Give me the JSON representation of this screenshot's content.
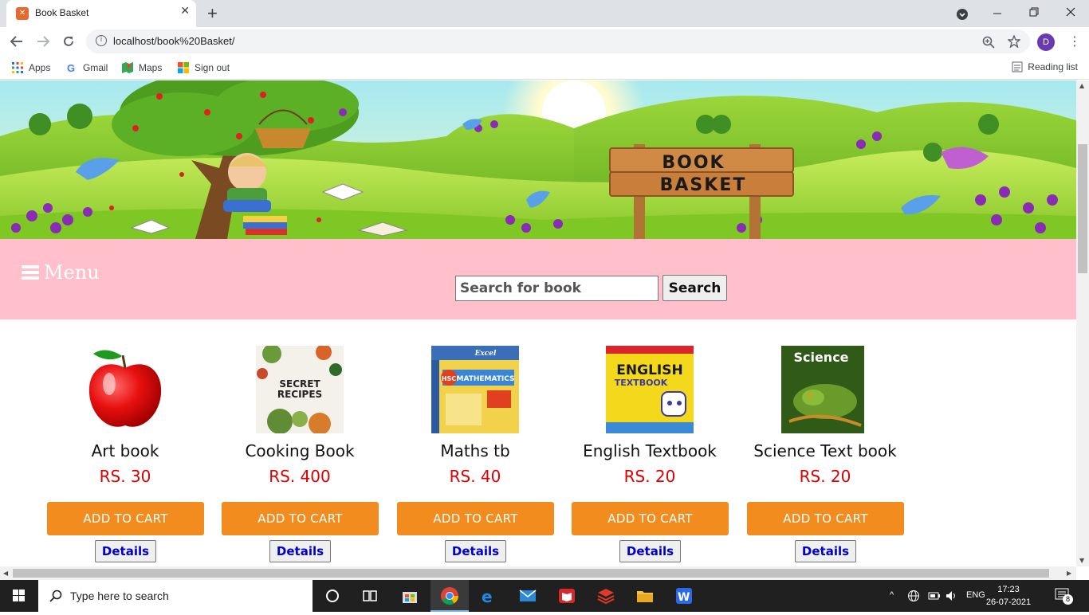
{
  "browser": {
    "tab_title": "Book Basket",
    "new_tab": "+",
    "close_tab": "✕",
    "url": "localhost/book%20Basket/",
    "profile_initial": "D",
    "bookmarks": [
      {
        "label": "Apps",
        "icon": "apps-grid-icon"
      },
      {
        "label": "Gmail",
        "icon": "google-icon"
      },
      {
        "label": "Maps",
        "icon": "maps-icon"
      },
      {
        "label": "Sign out",
        "icon": "microsoft-icon"
      }
    ],
    "reading_list": "Reading list"
  },
  "banner": {
    "sign_line1": "BOOK",
    "sign_line2": "BASKET"
  },
  "nav": {
    "menu_label": "Menu",
    "search_placeholder": "Search for book",
    "search_button": "Search"
  },
  "products": [
    {
      "name": "Art book",
      "price": "RS. 30",
      "cart": "ADD TO CART",
      "details": "Details",
      "image": "apple"
    },
    {
      "name": "Cooking Book",
      "price": "RS. 400",
      "cart": "ADD TO CART",
      "details": "Details",
      "image": "secret-recipes-cover",
      "cover_text1": "SECRET",
      "cover_text2": "RECIPES"
    },
    {
      "name": "Maths tb",
      "price": "RS. 40",
      "cart": "ADD TO CART",
      "details": "Details",
      "image": "hsc-mathematics-cover",
      "cover_text1": "Excel",
      "cover_text2": "HSC",
      "cover_text3": "MATHEMATICS"
    },
    {
      "name": "English Textbook",
      "price": "RS. 20",
      "cart": "ADD TO CART",
      "details": "Details",
      "image": "english-textbook-cover",
      "cover_text1": "ENGLISH",
      "cover_text2": "TEXTBOOK"
    },
    {
      "name": "Science Text book",
      "price": "RS. 20",
      "cart": "ADD TO CART",
      "details": "Details",
      "image": "science-cover",
      "cover_text1": "Science"
    }
  ],
  "taskbar": {
    "search_placeholder": "Type here to search",
    "language": "ENG",
    "time": "17:23",
    "date": "26-07-2021",
    "notifications": "8"
  },
  "colors": {
    "pink_bar": "#ffc0cb",
    "cart_button": "#f28c1e",
    "price": "#e00000",
    "details_text": "#0000cc"
  }
}
